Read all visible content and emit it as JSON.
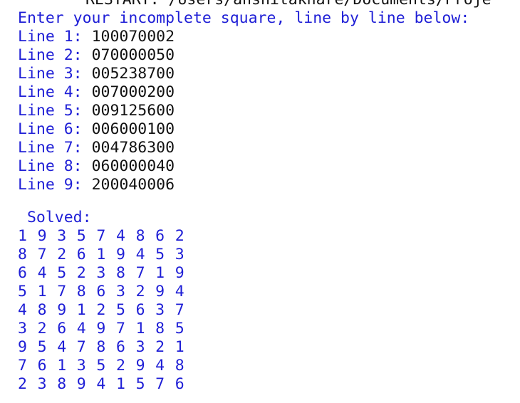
{
  "header_cut": "RESTART: /Users/anshitakhare/Documents/Proje",
  "intro": "Enter your incomplete square, line by line below:",
  "input_lines": [
    {
      "label": "Line 1: ",
      "value": "100070002"
    },
    {
      "label": "Line 2: ",
      "value": "070000050"
    },
    {
      "label": "Line 3: ",
      "value": "005238700"
    },
    {
      "label": "Line 4: ",
      "value": "007000200"
    },
    {
      "label": "Line 5: ",
      "value": "009125600"
    },
    {
      "label": "Line 6: ",
      "value": "006000100"
    },
    {
      "label": "Line 7: ",
      "value": "004786300"
    },
    {
      "label": "Line 8: ",
      "value": "060000040"
    },
    {
      "label": "Line 9: ",
      "value": "200040006"
    }
  ],
  "solved_label": " Solved:",
  "solution": [
    [
      "1",
      "9",
      "3",
      "5",
      "7",
      "4",
      "8",
      "6",
      "2"
    ],
    [
      "8",
      "7",
      "2",
      "6",
      "1",
      "9",
      "4",
      "5",
      "3"
    ],
    [
      "6",
      "4",
      "5",
      "2",
      "3",
      "8",
      "7",
      "1",
      "9"
    ],
    [
      "5",
      "1",
      "7",
      "8",
      "6",
      "3",
      "2",
      "9",
      "4"
    ],
    [
      "4",
      "8",
      "9",
      "1",
      "2",
      "5",
      "6",
      "3",
      "7"
    ],
    [
      "3",
      "2",
      "6",
      "4",
      "9",
      "7",
      "1",
      "8",
      "5"
    ],
    [
      "9",
      "5",
      "4",
      "7",
      "8",
      "6",
      "3",
      "2",
      "1"
    ],
    [
      "7",
      "6",
      "1",
      "3",
      "5",
      "2",
      "9",
      "4",
      "8"
    ],
    [
      "2",
      "3",
      "8",
      "9",
      "4",
      "1",
      "5",
      "7",
      "6"
    ]
  ],
  "colors": {
    "output_blue": "#1e1ed6",
    "input_black": "#111111",
    "background": "#ffffff"
  }
}
